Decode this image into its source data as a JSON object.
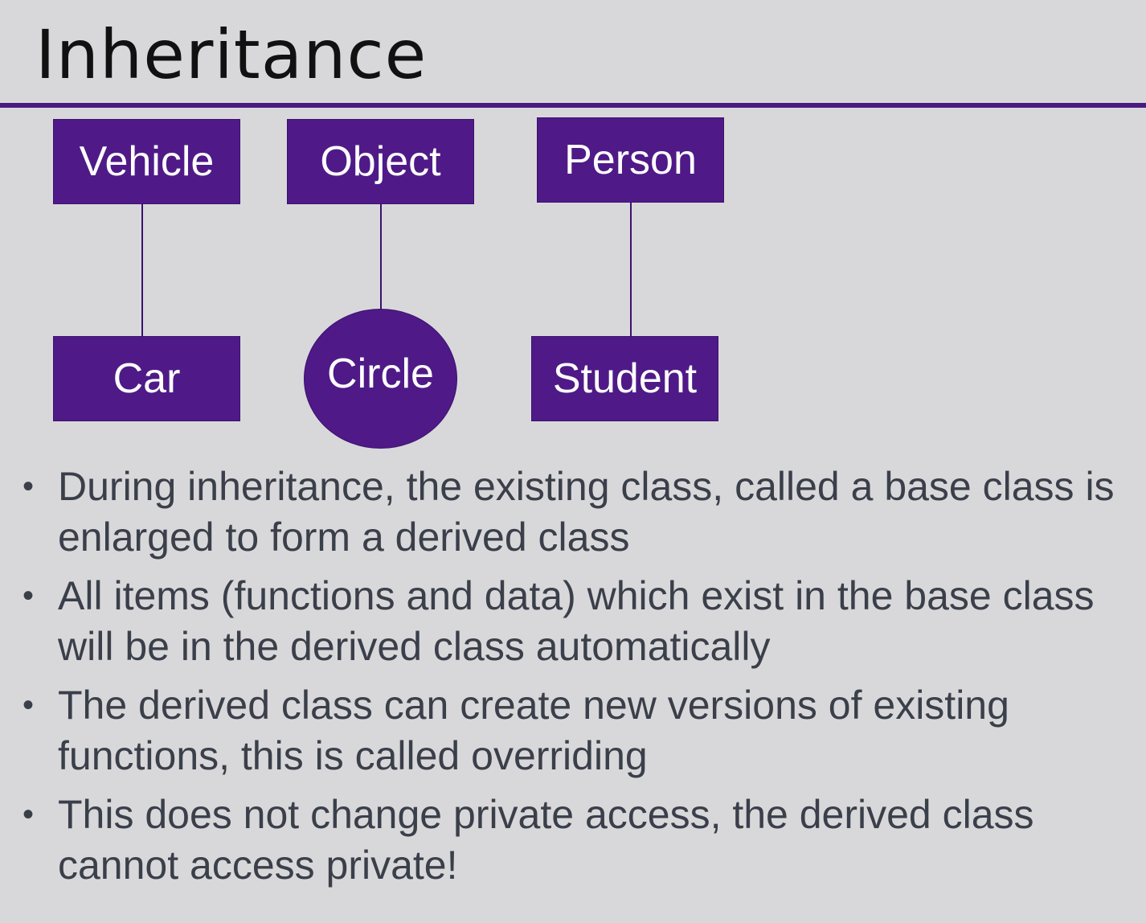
{
  "slide": {
    "title": "Inheritance"
  },
  "diagram": {
    "nodes": {
      "vehicle": "Vehicle",
      "object": "Object",
      "person": "Person",
      "car": "Car",
      "circle": "Circle",
      "student": "Student"
    }
  },
  "bullets": [
    "During inheritance, the existing class, called a base class is enlarged to form a derived class",
    "All items (functions and data) which exist in the base class will be in the derived class automatically",
    "The derived class can create new versions of existing functions, this is called overriding",
    "This does not change private access, the derived class cannot access private!"
  ],
  "bullet_marker": "•",
  "colors": {
    "accent": "#4f1a87",
    "rule": "#4a1a80",
    "text": "#3a3f4a",
    "background": "#d8d8da"
  }
}
